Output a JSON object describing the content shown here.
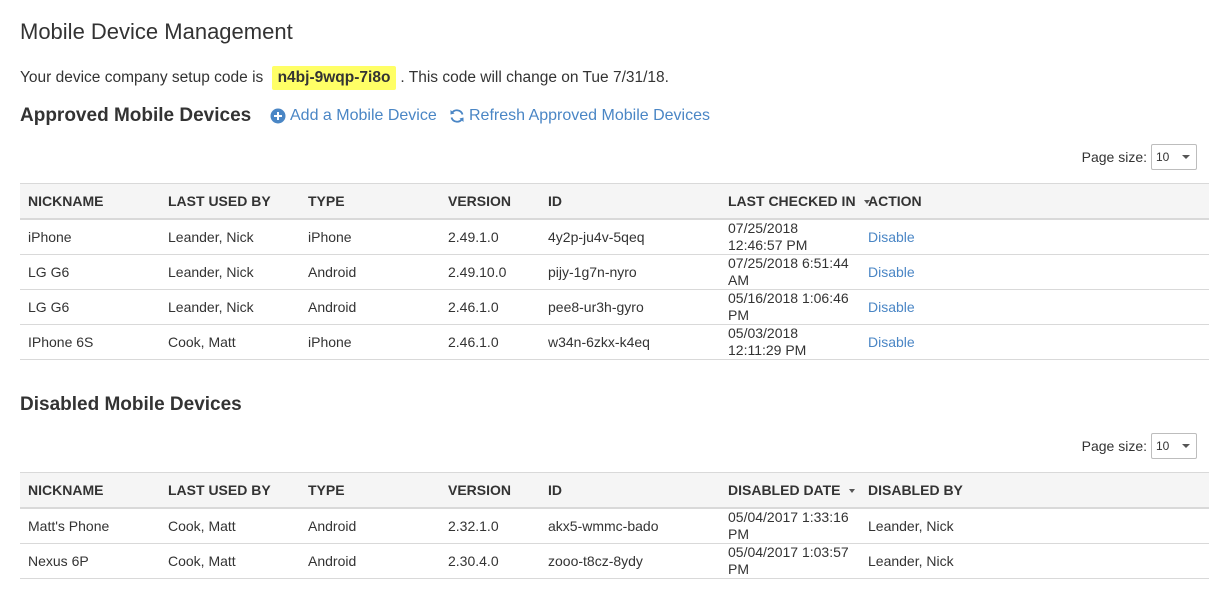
{
  "page": {
    "title": "Mobile Device Management"
  },
  "setup": {
    "prefix": "Your device company setup code is",
    "code": "n4bj-9wqp-7i8o",
    "suffix": ". This code will change on Tue 7/31/18."
  },
  "approved": {
    "title": "Approved Mobile Devices",
    "add_label": "Add a Mobile Device",
    "refresh_label": "Refresh Approved Mobile Devices",
    "page_size_label": "Page size:",
    "page_size_value": "10",
    "columns": [
      "NICKNAME",
      "LAST USED BY",
      "TYPE",
      "VERSION",
      "ID",
      "LAST CHECKED IN",
      "ACTION"
    ],
    "rows": [
      {
        "nickname": "iPhone",
        "last_used_by": "Leander, Nick",
        "type": "iPhone",
        "version": "2.49.1.0",
        "id": "4y2p-ju4v-5qeq",
        "checked_in": "07/25/2018 12:46:57 PM",
        "action": "Disable"
      },
      {
        "nickname": "LG G6",
        "last_used_by": "Leander, Nick",
        "type": "Android",
        "version": "2.49.10.0",
        "id": "pijy-1g7n-nyro",
        "checked_in": "07/25/2018 6:51:44 AM",
        "action": "Disable"
      },
      {
        "nickname": "LG G6",
        "last_used_by": "Leander, Nick",
        "type": "Android",
        "version": "2.46.1.0",
        "id": "pee8-ur3h-gyro",
        "checked_in": "05/16/2018 1:06:46 PM",
        "action": "Disable"
      },
      {
        "nickname": "IPhone 6S",
        "last_used_by": "Cook, Matt",
        "type": "iPhone",
        "version": "2.46.1.0",
        "id": "w34n-6zkx-k4eq",
        "checked_in": "05/03/2018 12:11:29 PM",
        "action": "Disable"
      }
    ]
  },
  "disabled": {
    "title": "Disabled Mobile Devices",
    "page_size_label": "Page size:",
    "page_size_value": "10",
    "columns": [
      "NICKNAME",
      "LAST USED BY",
      "TYPE",
      "VERSION",
      "ID",
      "DISABLED DATE",
      "DISABLED BY"
    ],
    "rows": [
      {
        "nickname": "Matt's Phone",
        "last_used_by": "Cook, Matt",
        "type": "Android",
        "version": "2.32.1.0",
        "id": "akx5-wmmc-bado",
        "disabled_date": "05/04/2017 1:33:16 PM",
        "disabled_by": "Leander, Nick"
      },
      {
        "nickname": "Nexus 6P",
        "last_used_by": "Cook, Matt",
        "type": "Android",
        "version": "2.30.4.0",
        "id": "zooo-t8cz-8ydy",
        "disabled_date": "05/04/2017 1:03:57 PM",
        "disabled_by": "Leander, Nick"
      }
    ]
  },
  "icons": {
    "add": "plus-circle-icon",
    "refresh": "refresh-icon",
    "dropdown": "caret-down-icon",
    "sort": "sort-desc-icon"
  },
  "colors": {
    "link": "#4a86c5",
    "code_highlight": "#ffff66",
    "header_bg": "#f5f5f5",
    "border": "#d9d9d9"
  }
}
